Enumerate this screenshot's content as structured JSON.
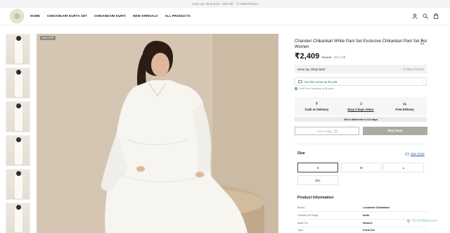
{
  "announcement": {
    "text": "Hurry Up, Shop Now! · 50% Off",
    "phone": "✆ 09910756122"
  },
  "nav": [
    "HOME",
    "CHIKANKARI KURTA SET",
    "CHIKANKARI KURTI",
    "NEW ARRIVALS",
    "ALL PRODUCTS"
  ],
  "header_icons": [
    "user-icon",
    "search-icon",
    "bag-icon"
  ],
  "gallery": {
    "thumbnail_count": 6,
    "badge": "50% OFF"
  },
  "product": {
    "title": "Chanderi Chikankari White Pant Set Exclusive Chikankari Pant Set For Women",
    "price": "₹2,409",
    "mrp": "₹5,049",
    "discount": "52% Off"
  },
  "hurry": {
    "text": "Hurry Up, Shop Now!",
    "phone": "✆ 09910756122"
  },
  "offer": {
    "text": "Get this at low as ₹2,129",
    "chevron": "›"
  },
  "tax_note": "Final Price inclusive of all taxes",
  "features": [
    {
      "icon": "rupee-icon",
      "label": "Cash on Delivery"
    },
    {
      "icon": "return-icon",
      "label": "Easy 5 days return"
    },
    {
      "icon": "truck-icon",
      "label": "Free Delivery"
    }
  ],
  "delivery_note": "Get it delivered in 4-9 days",
  "buttons": {
    "add_to_bag": "Add to bag",
    "buy_now": "Buy Now"
  },
  "size": {
    "label": "Size",
    "chart_link": "Size Chart",
    "options": [
      "S",
      "M",
      "L",
      "2XL"
    ],
    "selected": "S"
  },
  "product_info": {
    "title": "Product Information",
    "rows": [
      {
        "key": "Brand",
        "value": "Lucknowi Chikankari"
      },
      {
        "key": "Country Of Origin",
        "value": "India"
      },
      {
        "key": "Ideal For",
        "value": "Women"
      },
      {
        "key": "Type",
        "value": "Kurta Set"
      }
    ]
  },
  "watermark": "ScamMalware",
  "colors": {
    "accent_button": "#a9ad9f",
    "offer_green": "#1e7a32",
    "link_blue": "#2356a7"
  }
}
